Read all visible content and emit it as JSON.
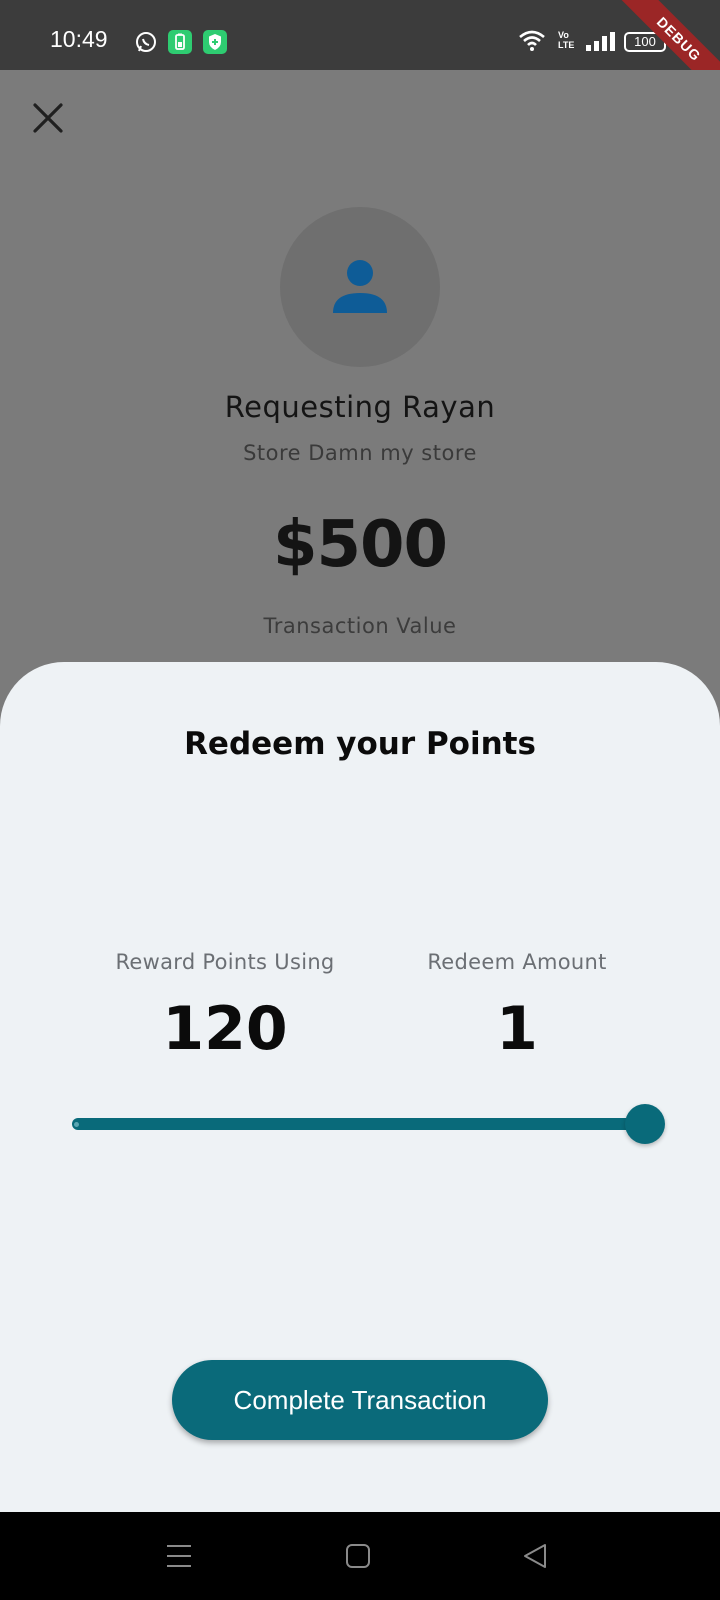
{
  "status_bar": {
    "time": "10:49",
    "volte_line1": "Vo",
    "volte_line2": "LTE",
    "battery": "100",
    "debug_banner": "DEBUG"
  },
  "request": {
    "requester": "Requesting Rayan",
    "store": "Store Damn my store",
    "amount": "$500",
    "amount_label": "Transaction Value"
  },
  "redeem_sheet": {
    "title": "Redeem your Points",
    "reward_points_label": "Reward Points Using",
    "reward_points_value": "120",
    "redeem_amount_label": "Redeem Amount",
    "redeem_amount_value": "1",
    "slider_level": 1.0,
    "complete_button_label": "Complete Transaction"
  },
  "icons": {
    "close": "close-icon",
    "avatar": "person-icon",
    "nav_menu": "menu-icon",
    "nav_home": "home-icon",
    "nav_back": "back-icon"
  },
  "colors": {
    "accent": "#0a6a7a",
    "sheet_background": "#eef2f5",
    "avatar_icon": "#0e5c97",
    "debug_banner": "#9b2626"
  }
}
